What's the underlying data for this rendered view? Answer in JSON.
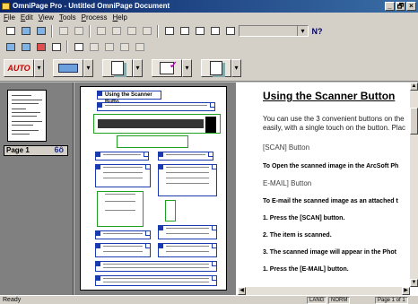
{
  "window": {
    "title": "OmniPage Pro - Untitled OmniPage Document",
    "controls": [
      "_",
      "🗗",
      "×"
    ]
  },
  "menu": [
    "File",
    "Edit",
    "View",
    "Tools",
    "Process",
    "Help"
  ],
  "toolbar": {
    "zoom_combo_value": "",
    "help_label": "N?"
  },
  "process_toolbar": {
    "auto_label": "AUTO"
  },
  "thumbnails": {
    "page_label": "Page 1",
    "zoom_glyph": "6ô"
  },
  "document": {
    "title_underlined": "Using",
    "title_rest": " the Scanner Button",
    "paragraph_1": "You can use the 3 convenient buttons on the",
    "paragraph_2": "easily, with a single touch on the button. Plac",
    "scan_heading": "[SCAN] Button",
    "scan_text": "To Open the scanned image in the ArcSoft Ph",
    "email_heading": "E-MAIL] Button",
    "email_text": "To E-mail the scanned image as an attached t",
    "step_1": "1. Press the [SCAN] button.",
    "step_2": "2. The item is scanned.",
    "step_3": "3. The scanned image will appear in the Phot",
    "step_4": "1. Press the [E-MAIL] button."
  },
  "page_image": {
    "heading": "Using the Scanner Butto"
  },
  "status": {
    "ready": "Ready",
    "lang": "LANG",
    "mode": "NORM",
    "page": "Page 1 of 1"
  }
}
